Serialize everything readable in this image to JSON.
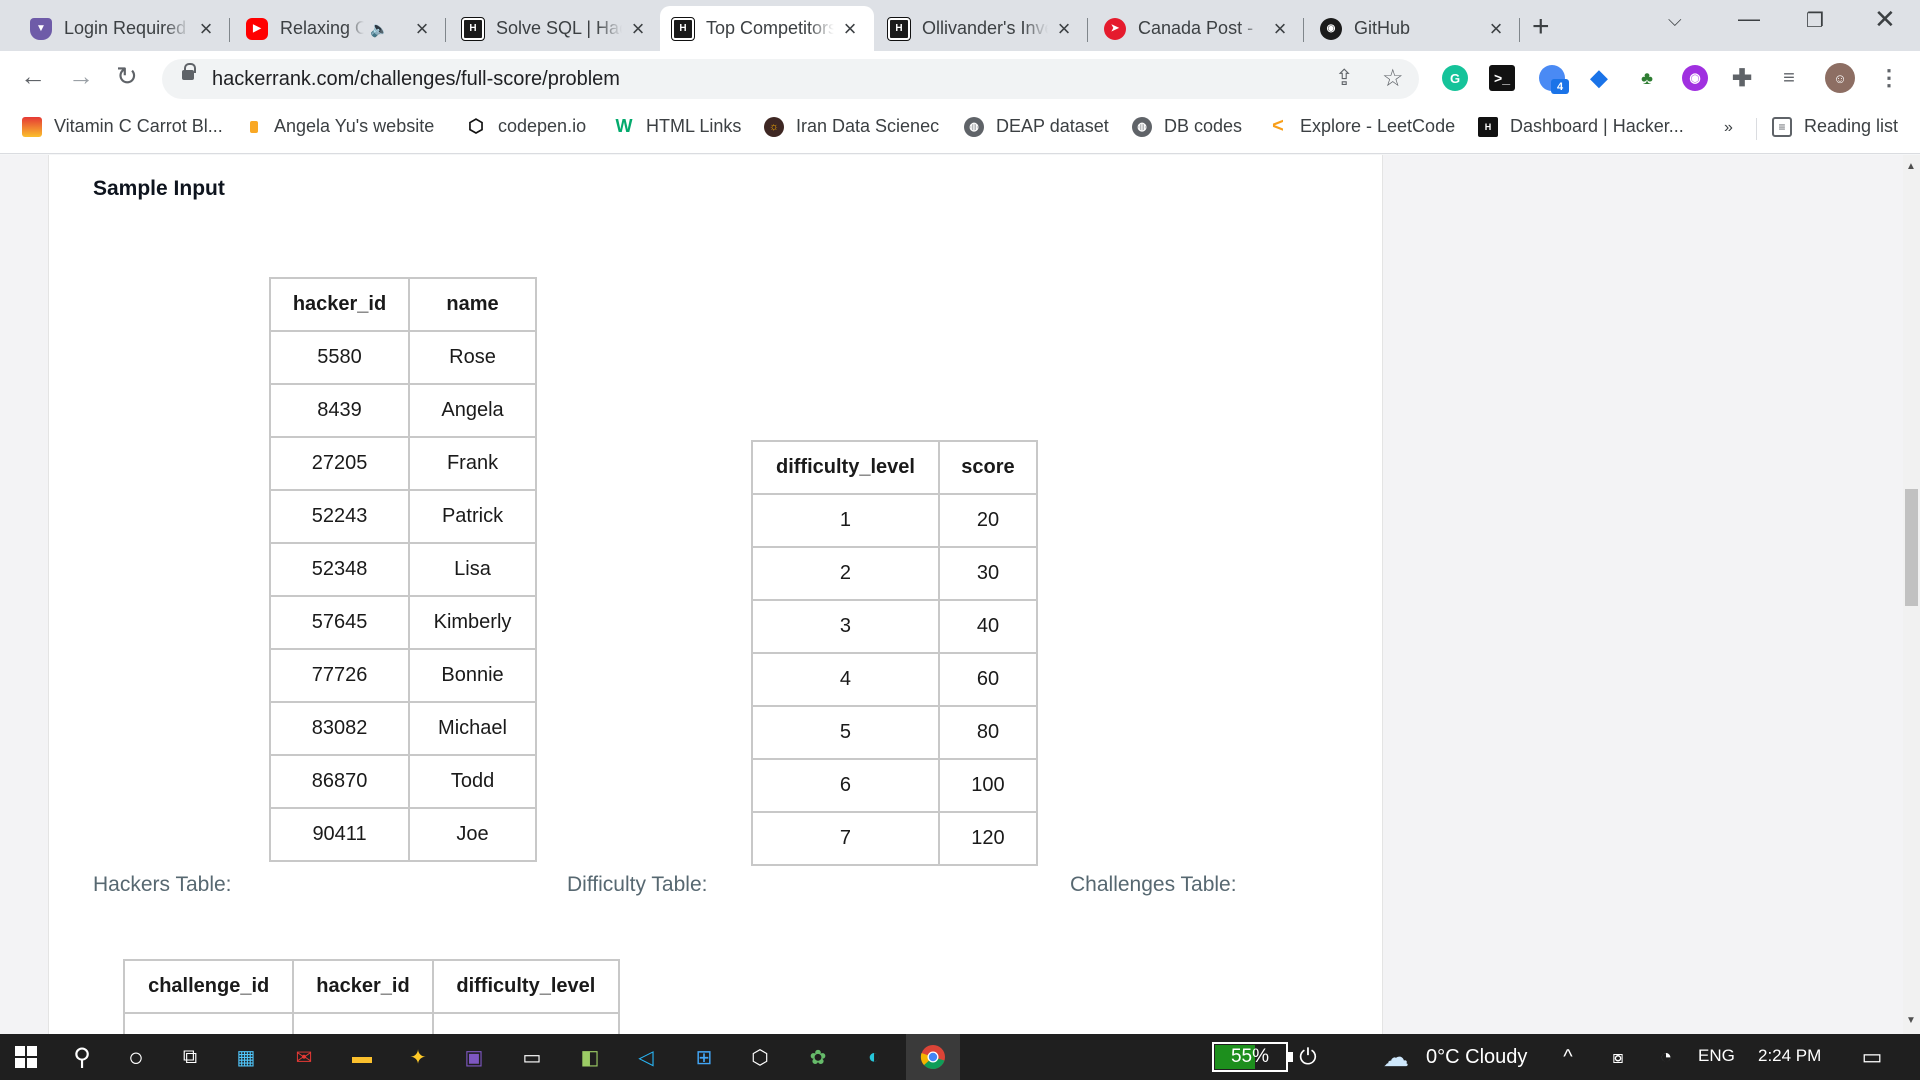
{
  "browser": {
    "tabs": [
      {
        "title": "Login Required",
        "icon": "shield-icon",
        "active": false
      },
      {
        "title": "Relaxing Oasis",
        "icon": "youtube-icon",
        "active": false,
        "audio": true
      },
      {
        "title": "Solve SQL | HackerRank",
        "icon": "hackerrank-icon",
        "active": false
      },
      {
        "title": "Top Competitors",
        "icon": "hackerrank-icon",
        "active": true
      },
      {
        "title": "Ollivander's Inventory",
        "icon": "hackerrank-icon",
        "active": false
      },
      {
        "title": "Canada Post - ",
        "icon": "canada-post-icon",
        "active": false
      },
      {
        "title": "GitHub",
        "icon": "github-icon",
        "active": false
      }
    ],
    "url": "hackerrank.com/challenges/full-score/problem",
    "extension_badge": "4",
    "bookmarks": [
      {
        "label": "Vitamin C Carrot Bl...",
        "icon": "bookmark-favicon-icon"
      },
      {
        "label": "Angela Yu's website",
        "icon": "bookmark-favicon-icon"
      },
      {
        "label": "codepen.io",
        "icon": "codepen-icon"
      },
      {
        "label": "HTML Links",
        "icon": "w3-icon"
      },
      {
        "label": "Iran Data Scienec",
        "icon": "bookmark-favicon-icon"
      },
      {
        "label": "DEAP dataset",
        "icon": "globe-icon"
      },
      {
        "label": "DB codes",
        "icon": "globe-icon"
      },
      {
        "label": "Explore - LeetCode",
        "icon": "leetcode-icon"
      },
      {
        "label": "Dashboard | Hacker...",
        "icon": "hackerrank-icon"
      }
    ],
    "bookmarks_overflow": "»",
    "reading_list": "Reading list"
  },
  "content": {
    "heading": "Sample Input",
    "hackers_table": {
      "headers": [
        "hacker_id",
        "name"
      ],
      "rows": [
        [
          "5580",
          "Rose"
        ],
        [
          "8439",
          "Angela"
        ],
        [
          "27205",
          "Frank"
        ],
        [
          "52243",
          "Patrick"
        ],
        [
          "52348",
          "Lisa"
        ],
        [
          "57645",
          "Kimberly"
        ],
        [
          "77726",
          "Bonnie"
        ],
        [
          "83082",
          "Michael"
        ],
        [
          "86870",
          "Todd"
        ],
        [
          "90411",
          "Joe"
        ]
      ]
    },
    "difficulty_table": {
      "headers": [
        "difficulty_level",
        "score"
      ],
      "rows": [
        [
          "1",
          "20"
        ],
        [
          "2",
          "30"
        ],
        [
          "3",
          "40"
        ],
        [
          "4",
          "60"
        ],
        [
          "5",
          "80"
        ],
        [
          "6",
          "100"
        ],
        [
          "7",
          "120"
        ]
      ]
    },
    "challenges_table": {
      "headers": [
        "challenge_id",
        "hacker_id",
        "difficulty_level"
      ]
    },
    "labels": {
      "hackers": "Hackers Table:",
      "difficulty": "Difficulty Table:",
      "challenges": "Challenges Table:"
    }
  },
  "taskbar": {
    "battery": "55%",
    "battery_level": 0.55,
    "weather": "0°C  Cloudy",
    "language": "ENG",
    "time": "2:24 PM"
  }
}
